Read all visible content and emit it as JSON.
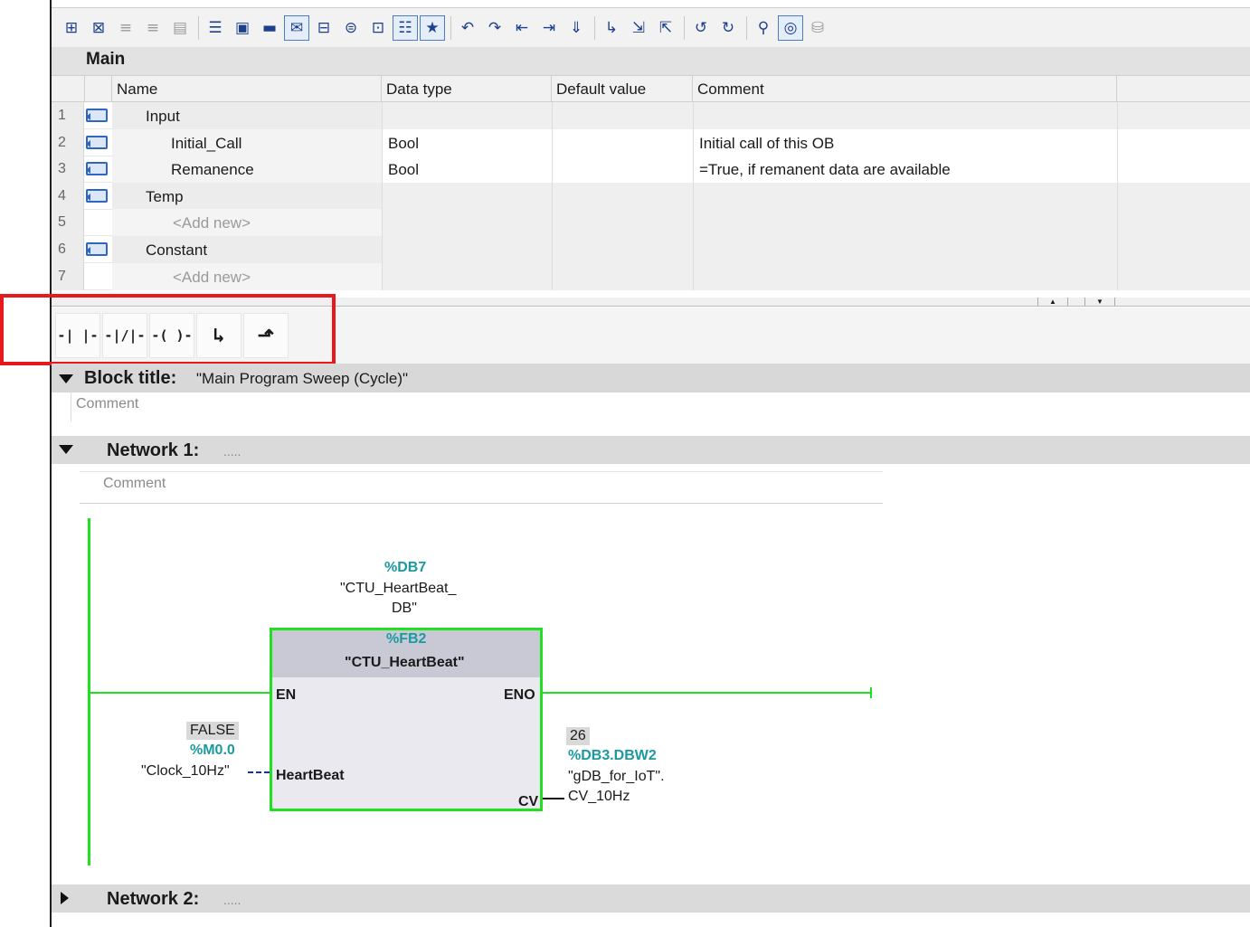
{
  "toolbar": {
    "icons": [
      "insert-row-icon",
      "delete-row-icon",
      "insert-row-above-icon",
      "insert-row-below-icon",
      "db-icon",
      "list-icon",
      "network-expand-icon",
      "network-collapse-icon",
      "comment-icon",
      "insert-input-icon",
      "insert-output-icon",
      "insert-inout-icon",
      "absolute-operands-icon",
      "favorites-icon",
      "clear-error-icon",
      "go-to-error-icon",
      "previous-network-icon",
      "next-network-icon",
      "download-icon",
      "call-icon",
      "indent-icon",
      "outdent-icon",
      "open-subnet-icon",
      "close-subnet-icon",
      "monitor-icon",
      "observe-icon",
      "breakpoints-icon"
    ]
  },
  "interface": {
    "title": "Main",
    "columns": [
      "Name",
      "Data type",
      "Default value",
      "Comment"
    ],
    "rows": [
      {
        "num": "1",
        "name": "Input",
        "type": "",
        "default": "",
        "comment": "",
        "kind": "section"
      },
      {
        "num": "2",
        "name": "Initial_Call",
        "type": "Bool",
        "default": "",
        "comment": "Initial call of this OB",
        "kind": "item"
      },
      {
        "num": "3",
        "name": "Remanence",
        "type": "Bool",
        "default": "",
        "comment": "=True, if remanent data are available",
        "kind": "item"
      },
      {
        "num": "4",
        "name": "Temp",
        "type": "",
        "default": "",
        "comment": "",
        "kind": "section"
      },
      {
        "num": "5",
        "name": "<Add new>",
        "type": "",
        "default": "",
        "comment": "",
        "kind": "add"
      },
      {
        "num": "6",
        "name": "Constant",
        "type": "",
        "default": "",
        "comment": "",
        "kind": "section"
      },
      {
        "num": "7",
        "name": "<Add new>",
        "type": "",
        "default": "",
        "comment": "",
        "kind": "add"
      }
    ]
  },
  "instructions": {
    "buttons": [
      {
        "name": "no-contact",
        "glyph": "-| |-"
      },
      {
        "name": "nc-contact",
        "glyph": "-|/|-"
      },
      {
        "name": "coil",
        "glyph": "-( )-"
      },
      {
        "name": "open-branch",
        "glyph": "↳"
      },
      {
        "name": "close-branch",
        "glyph": "⬏"
      }
    ]
  },
  "block": {
    "title_label": "Block title:",
    "title_value": "\"Main Program Sweep (Cycle)\"",
    "comment_placeholder": "Comment"
  },
  "network1": {
    "label": "Network 1:",
    "dots": ".....",
    "comment_placeholder": "Comment",
    "instance_db": "%DB7",
    "instance_name_1": "\"CTU_HeartBeat_",
    "instance_name_2": "DB\"",
    "fb_address": "%FB2",
    "fb_name": "\"CTU_HeartBeat\"",
    "pin_en": "EN",
    "pin_eno": "ENO",
    "pin_heartbeat": "HeartBeat",
    "pin_cv": "CV",
    "input_value": "FALSE",
    "input_address": "%M0.0",
    "input_tag": "\"Clock_10Hz\"",
    "output_value": "26",
    "output_address": "%DB3.DBW2",
    "output_tag_1": "\"gDB_for_IoT\".",
    "output_tag_2": "CV_10Hz"
  },
  "network2": {
    "label": "Network 2:",
    "dots": "....."
  },
  "colors": {
    "energized": "#21e021",
    "address_teal": "#1a9aa0",
    "highlight_red": "#e8191d"
  }
}
